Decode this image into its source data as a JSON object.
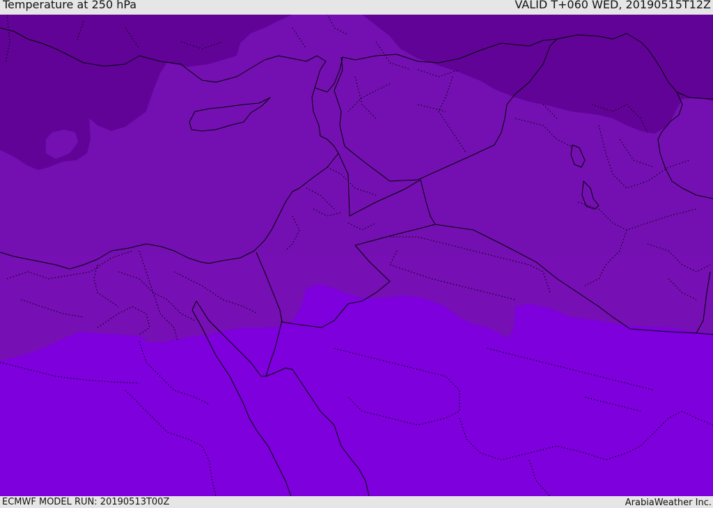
{
  "header": {
    "title": "Temperature at 250 hPa",
    "valid_time": "VALID T+060 WED, 20190515T12Z"
  },
  "footer": {
    "model_run": "ECMWF MODEL RUN: 20190513T00Z",
    "credit": "ArabiaWeather Inc."
  },
  "map": {
    "colors": {
      "coldest": "#620398",
      "cold": "#7410b2",
      "lower_band": "#7c0fb8",
      "warm": "#7e00dc"
    }
  }
}
